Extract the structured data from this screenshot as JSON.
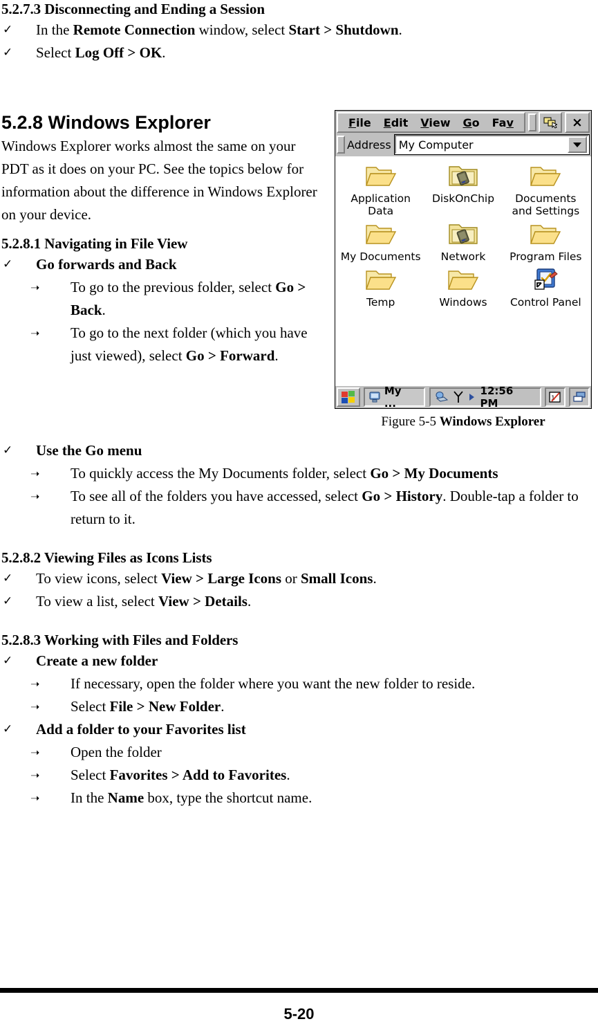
{
  "sections": {
    "s5273": {
      "heading": "5.2.7.3 Disconnecting and Ending a Session",
      "items": [
        {
          "marker": "✓",
          "pre": "In the ",
          "b1": "Remote Connection",
          "mid": " window, select ",
          "b2": "Start > Shutdown",
          "post": "."
        },
        {
          "marker": "✓",
          "pre": "Select ",
          "b1": "Log Off > OK",
          "mid": "",
          "b2": "",
          "post": "."
        }
      ]
    },
    "s528": {
      "heading": "5.2.8 Windows Explorer",
      "paragraph": "Windows Explorer works almost the same on your PDT as it does on your PC. See the topics below for information about the difference in Windows Explorer on your device."
    },
    "s5281": {
      "heading": "5.2.8.1 Navigating in File View",
      "group1_label": "Go forwards and Back",
      "group1_items": [
        {
          "pre": "To go to the previous folder, select ",
          "b": "Go > Back",
          "post": "."
        },
        {
          "pre": "To go to the next folder (which you have just viewed), select ",
          "b": "Go > Forward",
          "post": "."
        }
      ],
      "group2_label": "Use the Go menu",
      "group2_items": [
        {
          "pre": "To quickly access the My Documents folder, select ",
          "b": "Go > My Documents",
          "post": ""
        },
        {
          "pre": "To see all of the folders you have accessed, select ",
          "b": "Go > History",
          "post": ". Double-tap a folder to return to it."
        }
      ]
    },
    "s5282": {
      "heading": "5.2.8.2 Viewing Files as Icons Lists",
      "items": [
        {
          "marker": "✓",
          "pre": "To view icons, select ",
          "b1": "View > Large Icons",
          "mid": " or ",
          "b2": "Small Icons",
          "post": "."
        },
        {
          "marker": "✓",
          "pre": "To view a list, select ",
          "b1": "View > Details",
          "mid": "",
          "b2": "",
          "post": "."
        }
      ]
    },
    "s5283": {
      "heading": "5.2.8.3 Working with Files and Folders",
      "group1_label": "Create a new folder",
      "group1_items": [
        {
          "pre": "If necessary, open the folder where you want the new folder to reside.",
          "b": "",
          "post": ""
        },
        {
          "pre": "Select ",
          "b": "File > New Folder",
          "post": "."
        }
      ],
      "group2_label": "Add a folder to your Favorites list",
      "group2_items": [
        {
          "pre": "Open the folder",
          "b": "",
          "post": ""
        },
        {
          "pre": "Select ",
          "b": "Favorites > Add to Favorites",
          "post": "."
        },
        {
          "pre": "In the ",
          "b": "Name",
          "post": " box, type the shortcut name."
        }
      ]
    }
  },
  "figure": {
    "caption_prefix": "Figure 5-5 ",
    "caption_bold": "Windows Explorer",
    "window": {
      "menu_items": [
        {
          "accel": "F",
          "rest": "ile"
        },
        {
          "accel": "E",
          "rest": "dit"
        },
        {
          "accel": "V",
          "rest": "iew"
        },
        {
          "accel": "G",
          "rest": "o"
        },
        {
          "accel": "Fa",
          "rest": "v"
        }
      ],
      "close_label": "×",
      "address_label": "Address",
      "address_value": "My Computer",
      "icons": [
        {
          "label": "Application Data",
          "type": "folder-open"
        },
        {
          "label": "DiskOnChip",
          "type": "folder-chip"
        },
        {
          "label": "Documents and Settings",
          "type": "folder-open"
        },
        {
          "label": "My Documents",
          "type": "folder-open"
        },
        {
          "label": "Network",
          "type": "folder-chip"
        },
        {
          "label": "Program Files",
          "type": "folder-open"
        },
        {
          "label": "Temp",
          "type": "folder-open"
        },
        {
          "label": "Windows",
          "type": "folder-open"
        },
        {
          "label": "Control Panel",
          "type": "control-panel-shortcut"
        }
      ],
      "taskbar": {
        "task_label": "My ...",
        "clock": "12:56 PM"
      }
    }
  },
  "footer": {
    "page_number": "5-20"
  },
  "colors": {
    "folder_body": "#f5d97a",
    "folder_edge": "#c9a227",
    "chrome": "#c0c0c0",
    "accent_blue": "#2c4f9e"
  }
}
